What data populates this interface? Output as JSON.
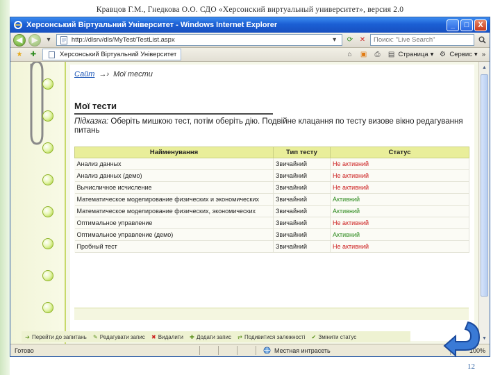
{
  "slide": {
    "caption": "Кравцов Г.М., Гнедкова О.О. СДО «Херсонский виртуальный университет», версия 2.0",
    "page_number": "12"
  },
  "window": {
    "title": "Херсонський Віртуальний Університет - Windows Internet Explorer",
    "buttons": [
      "_",
      "□",
      "X"
    ]
  },
  "address": {
    "url": "http://dlsrv/dls/MyTest/TestList.aspx",
    "search_placeholder": "Поиск: \"Live Search\""
  },
  "favorites": {
    "tab_label": "Херсонський Віртуальний Університет",
    "page_label": "Страница",
    "tools_label": "Сервис",
    "more": "»"
  },
  "page": {
    "breadcrumb": {
      "home": "Сайт",
      "arrow": "→›",
      "current": "Мої тести"
    },
    "title": "Мої тести",
    "hint_label": "Підказка:",
    "hint_text": "Оберіть мишкою тест, потім оберіть дію. Подвійне клацання по тесту визове вікно редагування питань"
  },
  "table": {
    "headers": [
      "Найменування",
      "Тип тесту",
      "Статус"
    ],
    "rows": [
      {
        "name": "Анализ данных",
        "type": "Звичайний",
        "status": "Не активний",
        "active": false
      },
      {
        "name": "Анализ данных (демо)",
        "type": "Звичайний",
        "status": "Не активний",
        "active": false
      },
      {
        "name": "Вычисличное исчисление",
        "type": "Звичайний",
        "status": "Не активний",
        "active": false
      },
      {
        "name": "Математическое моделирование физических и экономических",
        "type": "Звичайний",
        "status": "Активний",
        "active": true
      },
      {
        "name": "Математическое моделирование физических, экономических",
        "type": "Звичайний",
        "status": "Активний",
        "active": true
      },
      {
        "name": "Оптимальное управление",
        "type": "Звичайний",
        "status": "Не активний",
        "active": false
      },
      {
        "name": "Оптимальное управление (демо)",
        "type": "Звичайний",
        "status": "Активний",
        "active": true
      },
      {
        "name": "Пробный тест",
        "type": "Звичайний",
        "status": "Не активний",
        "active": false
      }
    ]
  },
  "actions": [
    {
      "label": "Перейти до запитань",
      "icon": "arrow-right-icon"
    },
    {
      "label": "Редагувати запис",
      "icon": "edit-icon"
    },
    {
      "label": "Видалити",
      "icon": "delete-icon"
    },
    {
      "label": "Додати запис",
      "icon": "plus-icon"
    },
    {
      "label": "Подивитися залежності",
      "icon": "link-icon"
    },
    {
      "label": "Змінити статус",
      "icon": "check-icon"
    }
  ],
  "statusbar": {
    "ready": "Готово",
    "zone": "Местная интрасеть",
    "zoom": "100%"
  },
  "colors": {
    "title_bar": "#1b5fd4",
    "table_header": "#e9ee9a",
    "status_active": "#2e8b1f",
    "status_inactive": "#cc1f1f",
    "binder_green": "#a6d02c"
  }
}
